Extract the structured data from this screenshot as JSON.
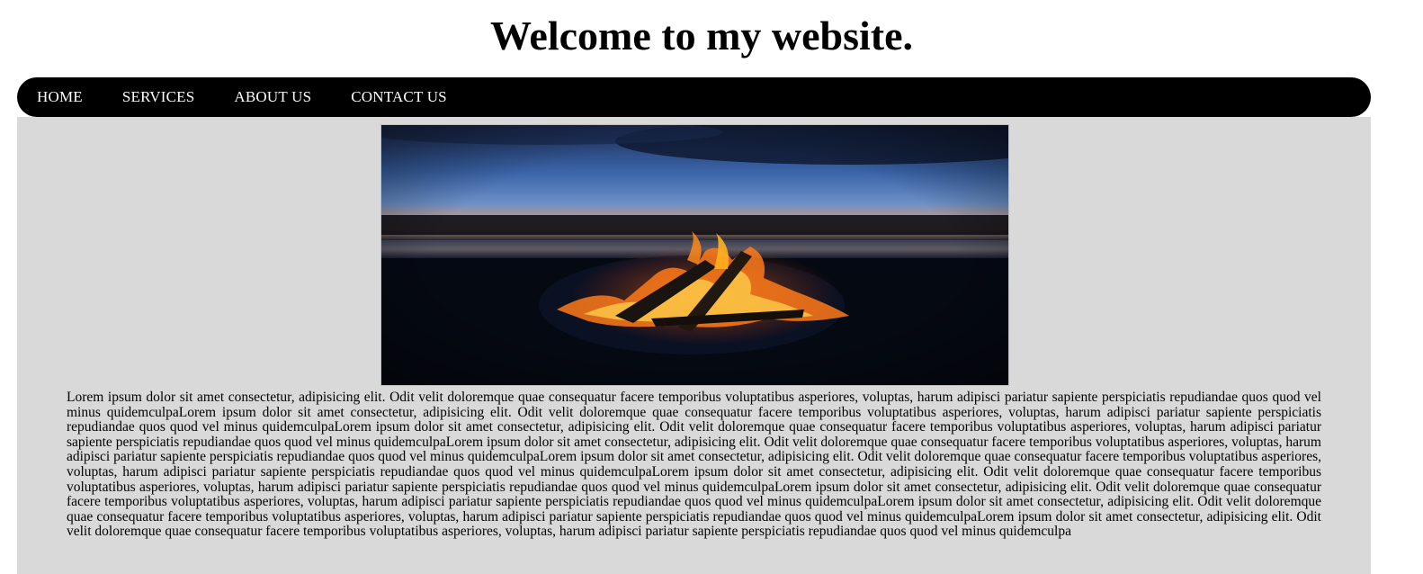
{
  "header": {
    "title": "Welcome to my website."
  },
  "nav": {
    "items": [
      {
        "label": "HOME"
      },
      {
        "label": "SERVICES"
      },
      {
        "label": "ABOUT US"
      },
      {
        "label": "CONTACT US"
      }
    ]
  },
  "main": {
    "hero_image": "campfire-at-dusk-lake",
    "paragraph": "Lorem ipsum dolor sit amet consectetur, adipisicing elit. Odit velit doloremque quae consequatur facere temporibus voluptatibus asperiores, voluptas, harum adipisci pariatur sapiente perspiciatis repudiandae quos quod vel minus quidemculpaLorem ipsum dolor sit amet consectetur, adipisicing elit. Odit velit doloremque quae consequatur facere temporibus voluptatibus asperiores, voluptas, harum adipisci pariatur sapiente perspiciatis repudiandae quos quod vel minus quidemculpaLorem ipsum dolor sit amet consectetur, adipisicing elit. Odit velit doloremque quae consequatur facere temporibus voluptatibus asperiores, voluptas, harum adipisci pariatur sapiente perspiciatis repudiandae quos quod vel minus quidemculpaLorem ipsum dolor sit amet consectetur, adipisicing elit. Odit velit doloremque quae consequatur facere temporibus voluptatibus asperiores, voluptas, harum adipisci pariatur sapiente perspiciatis repudiandae quos quod vel minus quidemculpaLorem ipsum dolor sit amet consectetur, adipisicing elit. Odit velit doloremque quae consequatur facere temporibus voluptatibus asperiores, voluptas, harum adipisci pariatur sapiente perspiciatis repudiandae quos quod vel minus quidemculpaLorem ipsum dolor sit amet consectetur, adipisicing elit. Odit velit doloremque quae consequatur facere temporibus voluptatibus asperiores, voluptas, harum adipisci pariatur sapiente perspiciatis repudiandae quos quod vel minus quidemculpaLorem ipsum dolor sit amet consectetur, adipisicing elit. Odit velit doloremque quae consequatur facere temporibus voluptatibus asperiores, voluptas, harum adipisci pariatur sapiente perspiciatis repudiandae quos quod vel minus quidemculpaLorem ipsum dolor sit amet consectetur, adipisicing elit. Odit velit doloremque quae consequatur facere temporibus voluptatibus asperiores, voluptas, harum adipisci pariatur sapiente perspiciatis repudiandae quos quod vel minus quidemculpaLorem ipsum dolor sit amet consectetur, adipisicing elit. Odit velit doloremque quae consequatur facere temporibus voluptatibus asperiores, voluptas, harum adipisci pariatur sapiente perspiciatis repudiandae quos quod vel minus quidemculpa"
  },
  "colors": {
    "nav_bg": "#000000",
    "content_bg": "#d9d9d9",
    "nav_text": "#ffffff"
  }
}
